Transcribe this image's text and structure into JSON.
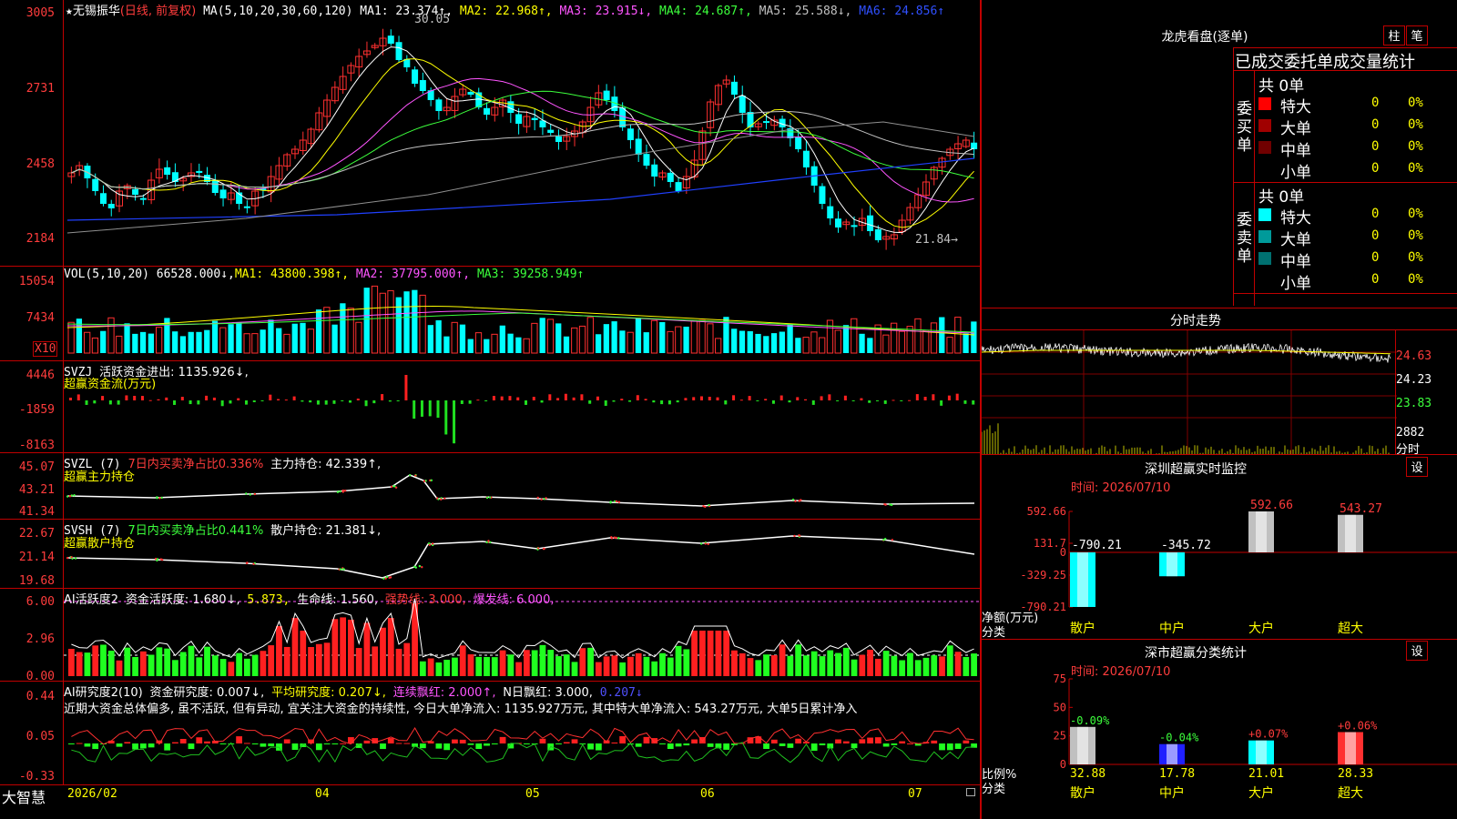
{
  "main": {
    "title_star": "★",
    "stock_name": "无锡振华",
    "chart_mode": "(日线, 前复权)",
    "ma_label": "MA(5,10,20,30,60,120)",
    "ma_values": [
      {
        "label": "MA1: 23.374↑,",
        "color": "#ffffff"
      },
      {
        "label": "MA2: 22.968↑,",
        "color": "#ffff00"
      },
      {
        "label": "MA3: 23.915↓,",
        "color": "#ff55ff"
      },
      {
        "label": "MA4: 24.687↑,",
        "color": "#3cff3c"
      },
      {
        "label": "MA5: 25.588↓,",
        "color": "#c0c0c0"
      },
      {
        "label": "MA6: 24.856↑",
        "color": "#3050ff"
      }
    ],
    "high_label": "30.05",
    "low_label": "21.84→",
    "y_ticks": [
      "3005",
      "2731",
      "2458",
      "2184"
    ],
    "x_labels": [
      "2026/02",
      "04",
      "05",
      "06",
      "07"
    ]
  },
  "vol": {
    "label": "VOL(5,10,20)",
    "value": "66528.000↓,",
    "ma1": "MA1: 43800.398↑,",
    "ma2": "MA2: 37795.000↑,",
    "ma3": "MA3: 39258.949↑",
    "y_ticks": [
      "15054",
      "7434"
    ],
    "unit": "X10"
  },
  "svzj": {
    "label": "SVZJ",
    "line1": "活跃资金进出: 1135.926↓,",
    "line2": "超赢资金流(万元)",
    "y_ticks": [
      "4446",
      "-1859",
      "-8163"
    ]
  },
  "svzl": {
    "label": "SVZL (7)",
    "ratio": "7日内买卖净占比0.336%",
    "hold": "主力持仓: 42.339↑,",
    "line2": "超赢主力持仓",
    "y_ticks": [
      "45.07",
      "43.21",
      "41.34"
    ]
  },
  "svsh": {
    "label": "SVSH (7)",
    "ratio": "7日内买卖净占比0.441%",
    "hold": "散户持仓: 21.381↓,",
    "line2": "超赢散户持仓",
    "y_ticks": [
      "22.67",
      "21.14",
      "19.68"
    ]
  },
  "ai1": {
    "label": "AI活跃度2",
    "v1": "资金活跃度: 1.680↓,",
    "v2": "5.873,",
    "v3": "生命线: 1.560,",
    "v4": "强势线: 3.000,",
    "v5": "爆发线: 6.000,",
    "y_ticks": [
      "6.00",
      "2.96",
      "0.00"
    ]
  },
  "ai2": {
    "label": "AI研究度2(10)",
    "v1": "资金研究度: 0.007↓,",
    "v2": "平均研究度: 0.207↓,",
    "v3": "连续飘红: 2.000↑,",
    "v4": "N日飘红: 3.000,",
    "v5": "0.207↓",
    "summary": "近期大资金总体偏多, 虽不活跃, 但有异动, 宜关注大资金的持续性, 今日大单净流入: 1135.927万元, 其中特大单净流入: 543.27万元, 大单5日累计净入",
    "y_ticks": [
      "0.44",
      "0.05",
      "-0.33"
    ]
  },
  "footer": {
    "brand": "大智慧"
  },
  "side": {
    "lhb_title": "龙虎看盘(逐单)",
    "btn_bar": "柱",
    "btn_pen": "笔",
    "tabs_line": "已成交委托单成交量统计",
    "buy": {
      "side_label": "委买单",
      "total": "共 0单",
      "rows": [
        {
          "label": "特大",
          "count": "0",
          "pct": "0%",
          "color": "#ff0000"
        },
        {
          "label": "大单",
          "count": "0",
          "pct": "0%",
          "color": "#a00000"
        },
        {
          "label": "中单",
          "count": "0",
          "pct": "0%",
          "color": "#700000"
        },
        {
          "label": "小单",
          "count": "0",
          "pct": "0%",
          "color": "#000000"
        }
      ]
    },
    "sell": {
      "side_label": "委卖单",
      "total": "共 0单",
      "rows": [
        {
          "label": "特大",
          "count": "0",
          "pct": "0%",
          "color": "#00ffff"
        },
        {
          "label": "大单",
          "count": "0",
          "pct": "0%",
          "color": "#009a9a"
        },
        {
          "label": "中单",
          "count": "0",
          "pct": "0%",
          "color": "#007070"
        },
        {
          "label": "小单",
          "count": "0",
          "pct": "0%",
          "color": "#000000"
        }
      ]
    },
    "intraday": {
      "title": "分时走势",
      "prices": [
        "24.63",
        "24.23",
        "23.83"
      ],
      "vol": "2882",
      "tag": "分时"
    },
    "sz_monitor": {
      "title": "深圳超赢实时监控",
      "btn": "设",
      "time": "时间: 2026/07/10",
      "y_ticks": [
        "592.66",
        "131.7",
        "0",
        "-329.25",
        "-790.21"
      ],
      "axis_label1": "净额(万元)",
      "axis_label2": "分类"
    },
    "sz_class": {
      "title": "深市超赢分类统计",
      "btn": "设",
      "time": "时间: 2026/07/10",
      "y_ticks": [
        "75",
        "50",
        "25",
        "0"
      ],
      "axis_label1": "比例%",
      "axis_label2": "分类"
    }
  },
  "chart_data": [
    {
      "type": "bar",
      "title": "深圳超赢实时监控",
      "ylabel": "净额(万元)",
      "xlabel": "分类",
      "categories": [
        "散户",
        "中户",
        "大户",
        "超大"
      ],
      "values": [
        -790.21,
        -345.72,
        592.66,
        543.27
      ],
      "labels": [
        "-790.21",
        "-345.72",
        "592.66",
        "543.27"
      ],
      "ylim": [
        -790.21,
        592.66
      ]
    },
    {
      "type": "bar",
      "title": "深市超赢分类统计",
      "ylabel": "比例%",
      "xlabel": "分类",
      "categories": [
        "散户",
        "中户",
        "大户",
        "超大"
      ],
      "values": [
        32.88,
        17.78,
        21.01,
        28.33
      ],
      "labels": [
        "32.88",
        "17.78",
        "21.01",
        "28.33"
      ],
      "changes": [
        "-0.09%",
        "-0.04%",
        "+0.07%",
        "+0.06%"
      ],
      "ylim": [
        0,
        75
      ]
    }
  ]
}
